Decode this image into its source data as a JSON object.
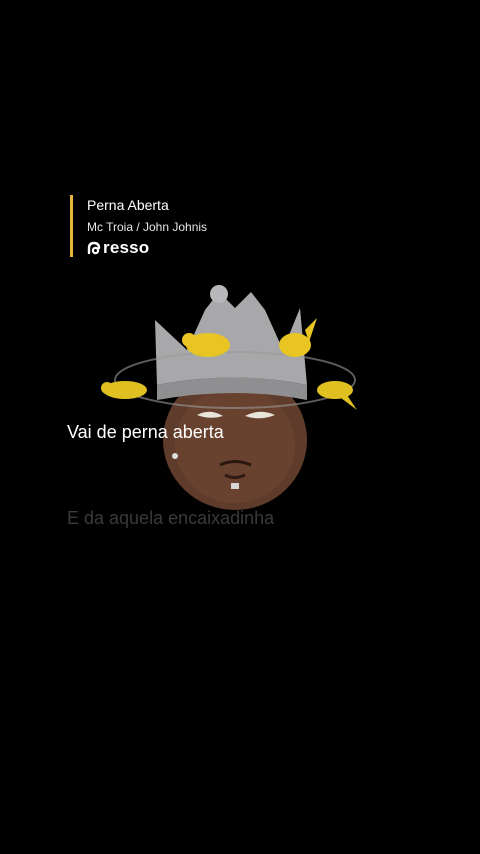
{
  "song": {
    "title": "Perna Aberta",
    "artist": "Mc Troia / John Johnis"
  },
  "brand": {
    "name": "resso",
    "icon": "resso-logo-icon",
    "accent_color": "#e8b53a"
  },
  "lyrics": {
    "current": "Vai de perna aberta",
    "next": "E da aquela encaixadinha"
  },
  "avatar": {
    "icon": "crowned-avatar-with-birds"
  }
}
